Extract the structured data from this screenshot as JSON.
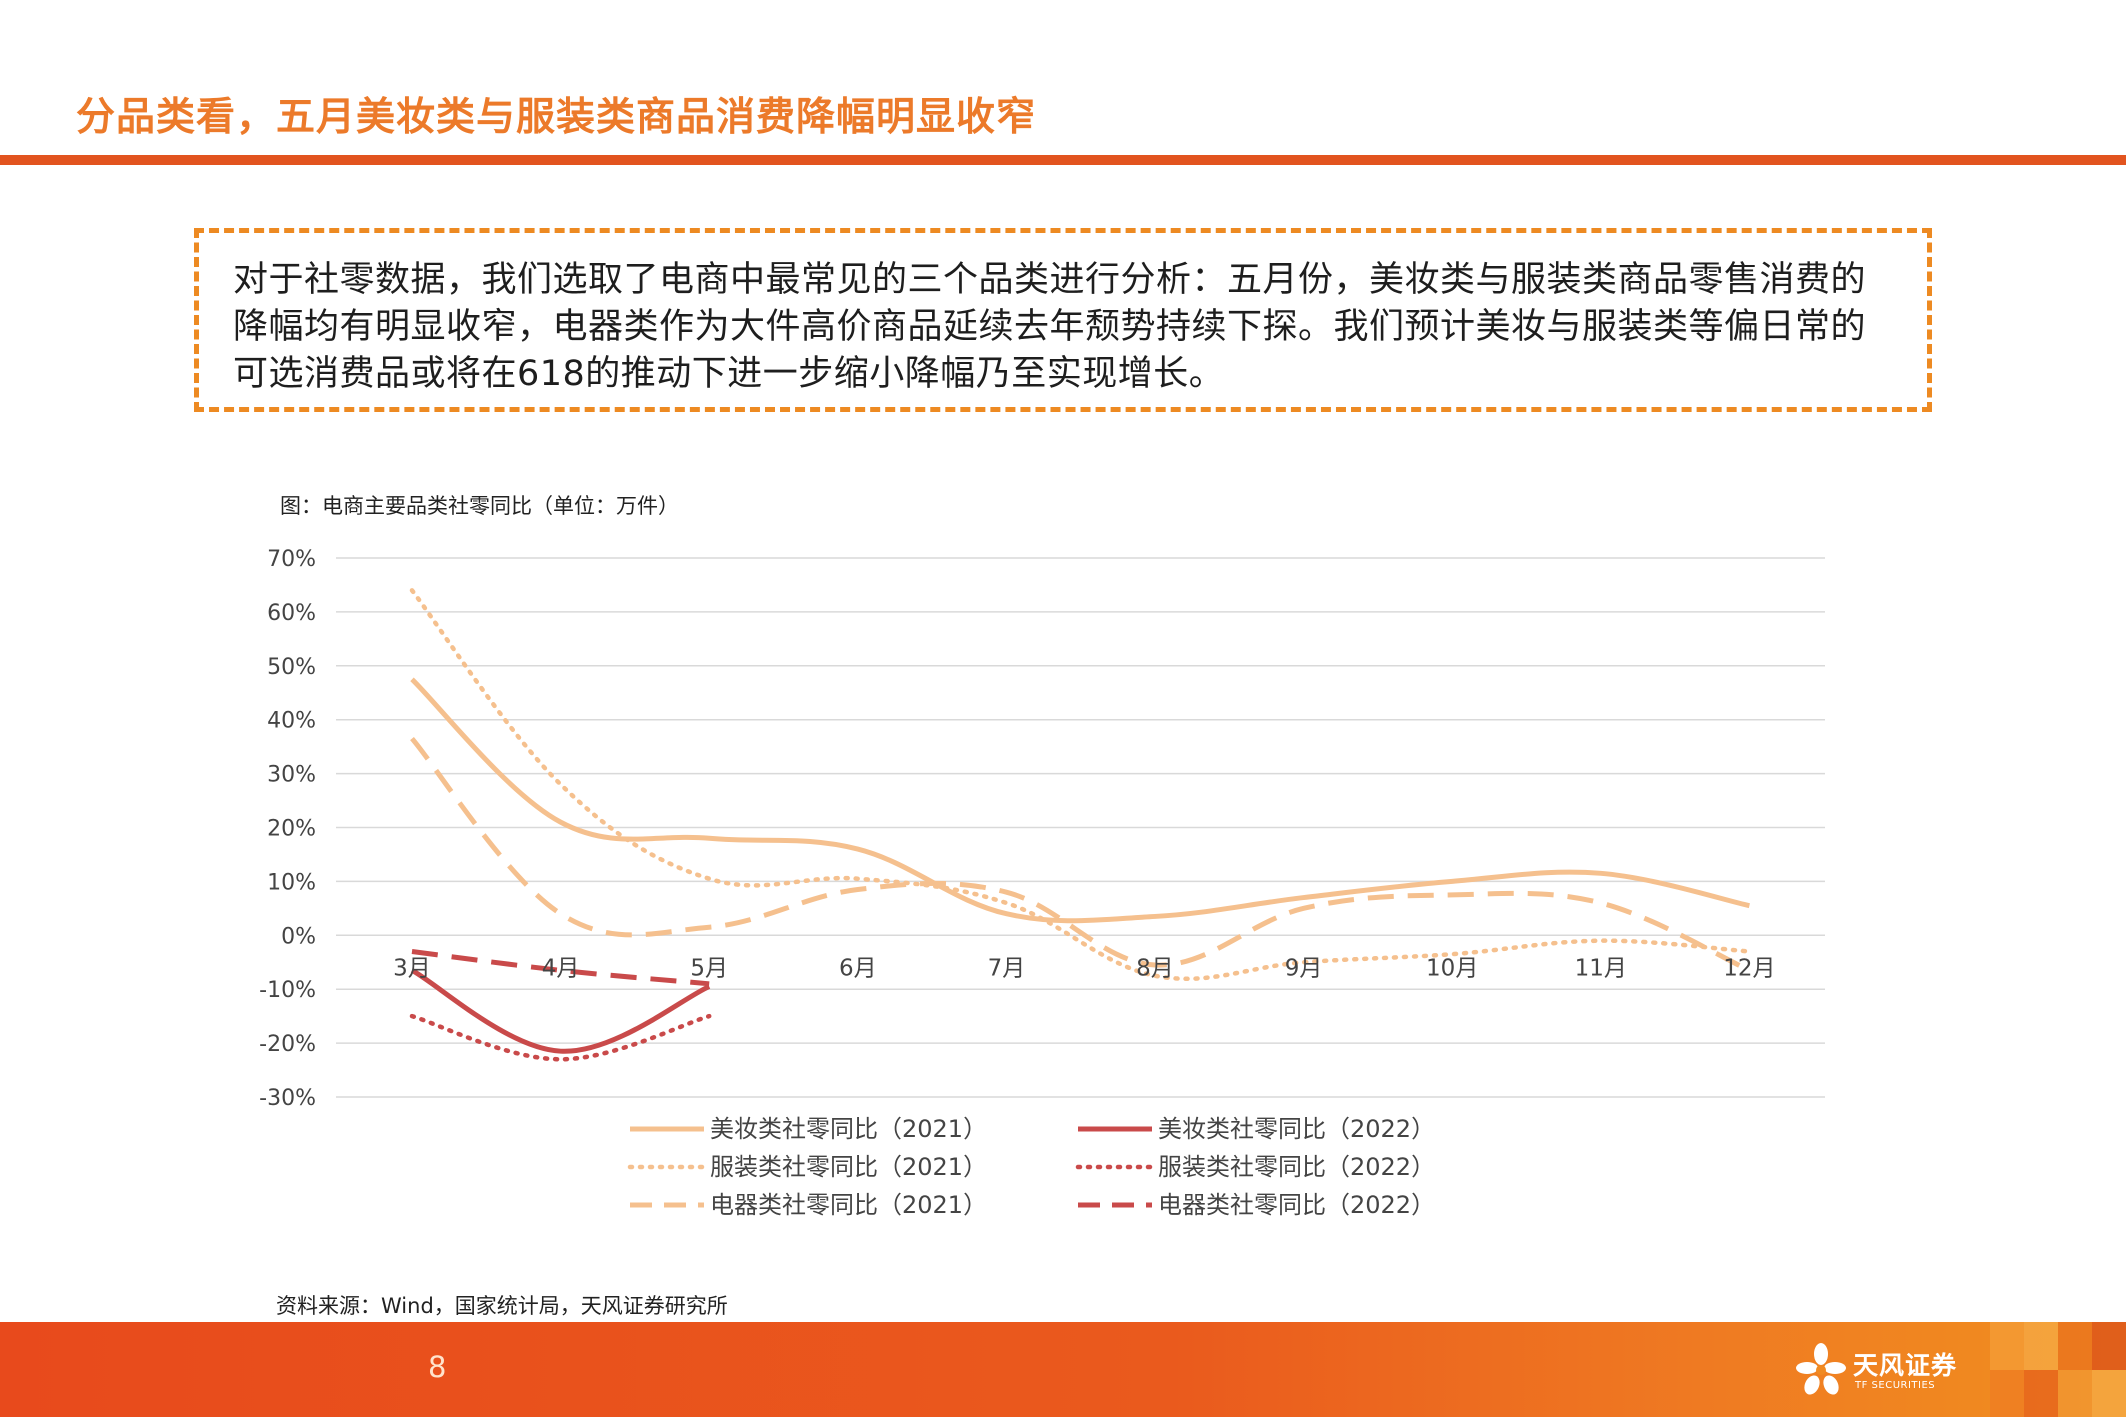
{
  "slide": {
    "title": "分品类看，五月美妆类与服装类商品消费降幅明显收窄",
    "callout_text": "对于社零数据，我们选取了电商中最常见的三个品类进行分析：五月份，美妆类与服装类商品零售消费的降幅均有明显收窄，电器类作为大件高价商品延续去年颓势持续下探。我们预计美妆与服装类等偏日常的可选消费品或将在618的推动下进一步缩小降幅乃至实现增长。",
    "chart_caption": "图：电商主要品类社零同比（单位：万件）",
    "source": "资料来源：Wind，国家统计局，天风证券研究所",
    "page_number": "8",
    "brand_cn": "天风证券",
    "brand_en": "TF SECURITIES"
  },
  "colors": {
    "accent_orange": "#ec7a2a",
    "rule_red": "#e2541f",
    "callout_border": "#ed8a22",
    "series_2021": "#f5c08e",
    "series_2022": "#c94a4a",
    "grid": "#d9d9d9"
  },
  "chart_data": {
    "type": "line",
    "title": "图：电商主要品类社零同比（单位：万件）",
    "categories": [
      "3月",
      "4月",
      "5月",
      "6月",
      "7月",
      "8月",
      "9月",
      "10月",
      "11月",
      "12月"
    ],
    "ylim": [
      -30,
      70
    ],
    "y_ticks": [
      "70%",
      "60%",
      "50%",
      "40%",
      "30%",
      "20%",
      "10%",
      "0%",
      "-10%",
      "-20%",
      "-30%"
    ],
    "y_tick_values": [
      70,
      60,
      50,
      40,
      30,
      20,
      10,
      0,
      -10,
      -20,
      -30
    ],
    "grid": true,
    "legend_position": "bottom",
    "series": [
      {
        "name": "美妆类社零同比（2021）",
        "style": "solid",
        "color": "#f5c08e",
        "values": [
          47.5,
          21,
          18,
          16,
          4,
          3.5,
          7,
          10,
          11.5,
          5.5
        ]
      },
      {
        "name": "美妆类社零同比（2022）",
        "style": "solid",
        "color": "#c94a4a",
        "values": [
          -6.5,
          -21.5,
          -9.5,
          null,
          null,
          null,
          null,
          null,
          null,
          null
        ]
      },
      {
        "name": "服装类社零同比（2021）",
        "style": "dotted",
        "color": "#f5c08e",
        "values": [
          64,
          28,
          10.5,
          10.5,
          6,
          -7.5,
          -5,
          -3.5,
          -1,
          -3
        ]
      },
      {
        "name": "服装类社零同比（2022）",
        "style": "dotted",
        "color": "#c94a4a",
        "values": [
          -15,
          -23,
          -15,
          null,
          null,
          null,
          null,
          null,
          null,
          null
        ]
      },
      {
        "name": "电器类社零同比（2021）",
        "style": "dashed",
        "color": "#f5c08e",
        "values": [
          36.5,
          4,
          1.5,
          8.5,
          8,
          -5.5,
          5,
          7.5,
          6,
          -6.5
        ]
      },
      {
        "name": "电器类社零同比（2022）",
        "style": "dashed",
        "color": "#c94a4a",
        "values": [
          -3,
          -6.5,
          -9,
          null,
          null,
          null,
          null,
          null,
          null,
          null
        ]
      }
    ],
    "legend": [
      {
        "label": "美妆类社零同比（2021）",
        "series": 0
      },
      {
        "label": "美妆类社零同比（2022）",
        "series": 1
      },
      {
        "label": "服装类社零同比（2021）",
        "series": 2
      },
      {
        "label": "服装类社零同比（2022）",
        "series": 3
      },
      {
        "label": "电器类社零同比（2021）",
        "series": 4
      },
      {
        "label": "电器类社零同比（2022）",
        "series": 5
      }
    ]
  }
}
